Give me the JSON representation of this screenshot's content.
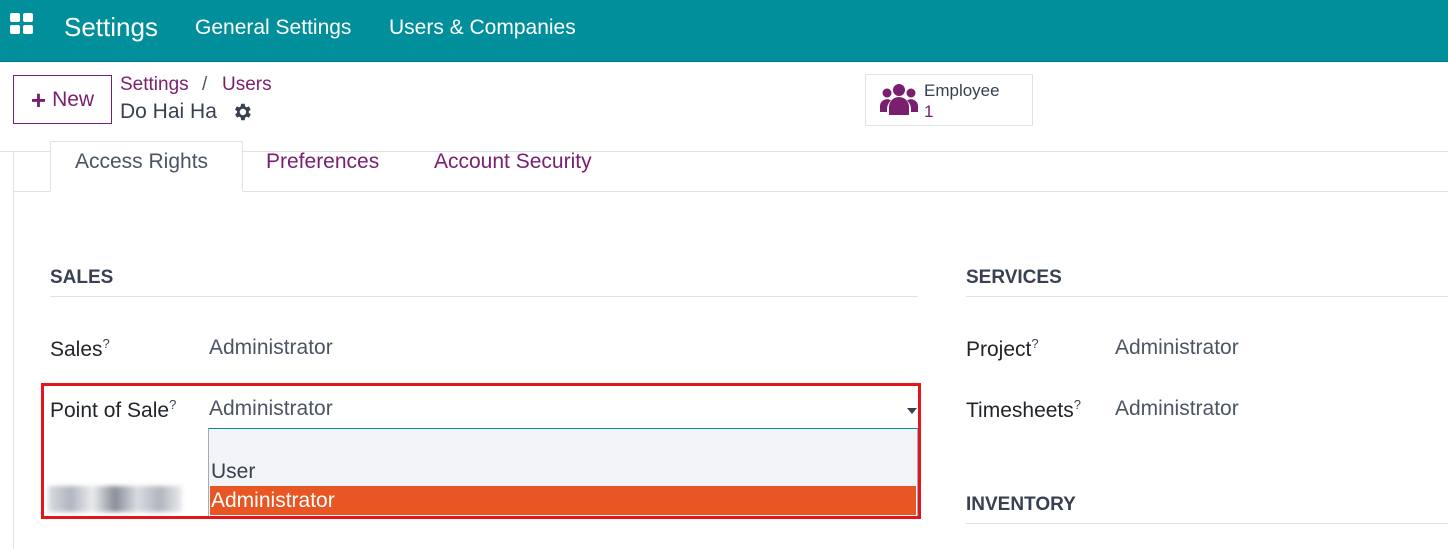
{
  "navbar": {
    "app_title": "Settings",
    "menu": [
      "General Settings",
      "Users & Companies"
    ],
    "bg_color": "#018f9c"
  },
  "control_panel": {
    "new_label": "New",
    "breadcrumb": {
      "parent": "Settings",
      "current": "Users"
    },
    "record_name": "Do Hai Ha",
    "smart_button": {
      "label": "Employee",
      "count": "1"
    }
  },
  "tabs": [
    {
      "label": "Access Rights",
      "active": true
    },
    {
      "label": "Preferences",
      "active": false
    },
    {
      "label": "Account Security",
      "active": false
    }
  ],
  "sections": {
    "sales": {
      "title": "SALES",
      "fields": [
        {
          "label": "Sales",
          "help": "?",
          "value": "Administrator"
        },
        {
          "label": "Point of Sale",
          "help": "?",
          "value": "Administrator"
        }
      ]
    },
    "services": {
      "title": "SERVICES",
      "fields": [
        {
          "label": "Project",
          "help": "?",
          "value": "Administrator"
        },
        {
          "label": "Timesheets",
          "help": "?",
          "value": "Administrator"
        }
      ]
    },
    "inventory": {
      "title": "INVENTORY"
    }
  },
  "dropdown": {
    "options": [
      "",
      "User",
      "Administrator"
    ],
    "selected": "Administrator",
    "highlight_color": "#e85624"
  },
  "colors": {
    "link": "#7a1f70",
    "annotation_border": "#e3161d"
  }
}
